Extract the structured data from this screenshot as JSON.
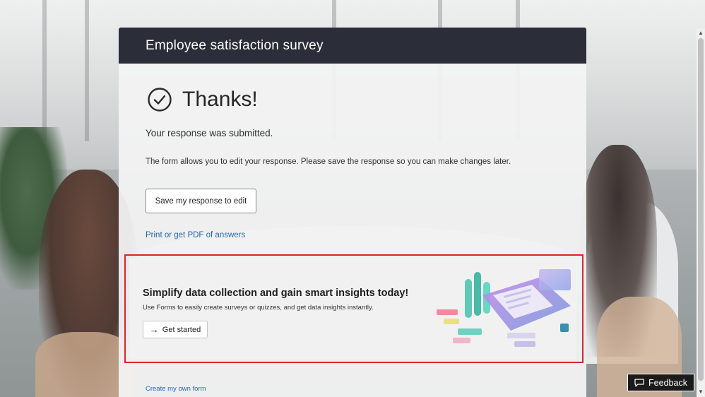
{
  "survey": {
    "title": "Employee satisfaction survey"
  },
  "confirmation": {
    "heading": "Thanks!",
    "submitted_text": "Your response was submitted.",
    "edit_note": "The form allows you to edit your response. Please save the response so you can make changes later.",
    "save_button": "Save my response to edit",
    "print_link": "Print or get PDF of answers"
  },
  "promo": {
    "title": "Simplify data collection and gain smart insights today!",
    "subtitle": "Use Forms to easily create surveys or quizzes, and get data insights instantly.",
    "button": "Get started",
    "button_icon": "arrow-right-icon"
  },
  "footer": {
    "create_link": "Create my own form"
  },
  "feedback": {
    "label": "Feedback",
    "icon": "chat-icon"
  },
  "colors": {
    "header_bg": "#2b2e38",
    "link": "#2266b4",
    "highlight": "#d9262b"
  }
}
